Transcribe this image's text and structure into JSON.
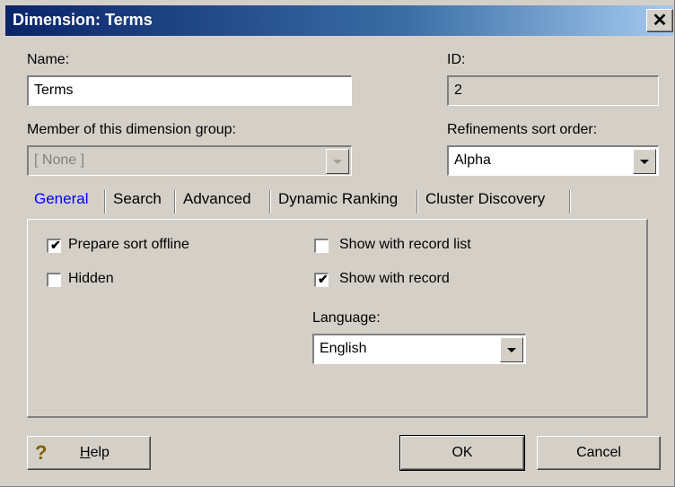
{
  "window": {
    "title": "Dimension:  Terms",
    "close_glyph": "✕"
  },
  "name": {
    "label": "Name:",
    "value": "Terms"
  },
  "id": {
    "label": "ID:",
    "value": "2"
  },
  "group": {
    "label": "Member of this dimension group:",
    "value": "[ None ]"
  },
  "refinements": {
    "label": "Refinements sort order:",
    "value": "Alpha"
  },
  "tabs": [
    {
      "label": "General",
      "active": true
    },
    {
      "label": "Search"
    },
    {
      "label": "Advanced"
    },
    {
      "label": "Dynamic Ranking"
    },
    {
      "label": "Cluster Discovery"
    }
  ],
  "general": {
    "prepare_sort_offline": {
      "label": "Prepare sort offline",
      "checked": true
    },
    "hidden": {
      "label": "Hidden",
      "checked": false
    },
    "show_with_record_list": {
      "label": "Show with record list",
      "checked": false
    },
    "show_with_record": {
      "label": "Show with record",
      "checked": true
    },
    "language": {
      "label": "Language:",
      "value": "English"
    }
  },
  "buttons": {
    "help": "Help",
    "help_mnemonic": "H",
    "help_rest": "elp",
    "ok": "OK",
    "cancel": "Cancel"
  },
  "icons": {
    "help": "question-mark-icon",
    "close": "close-icon",
    "dropdown": "chevron-down-icon"
  },
  "colors": {
    "title_bar": "#0a246a",
    "active_tab": "#0000ff",
    "window_face": "#d4d0c8"
  }
}
